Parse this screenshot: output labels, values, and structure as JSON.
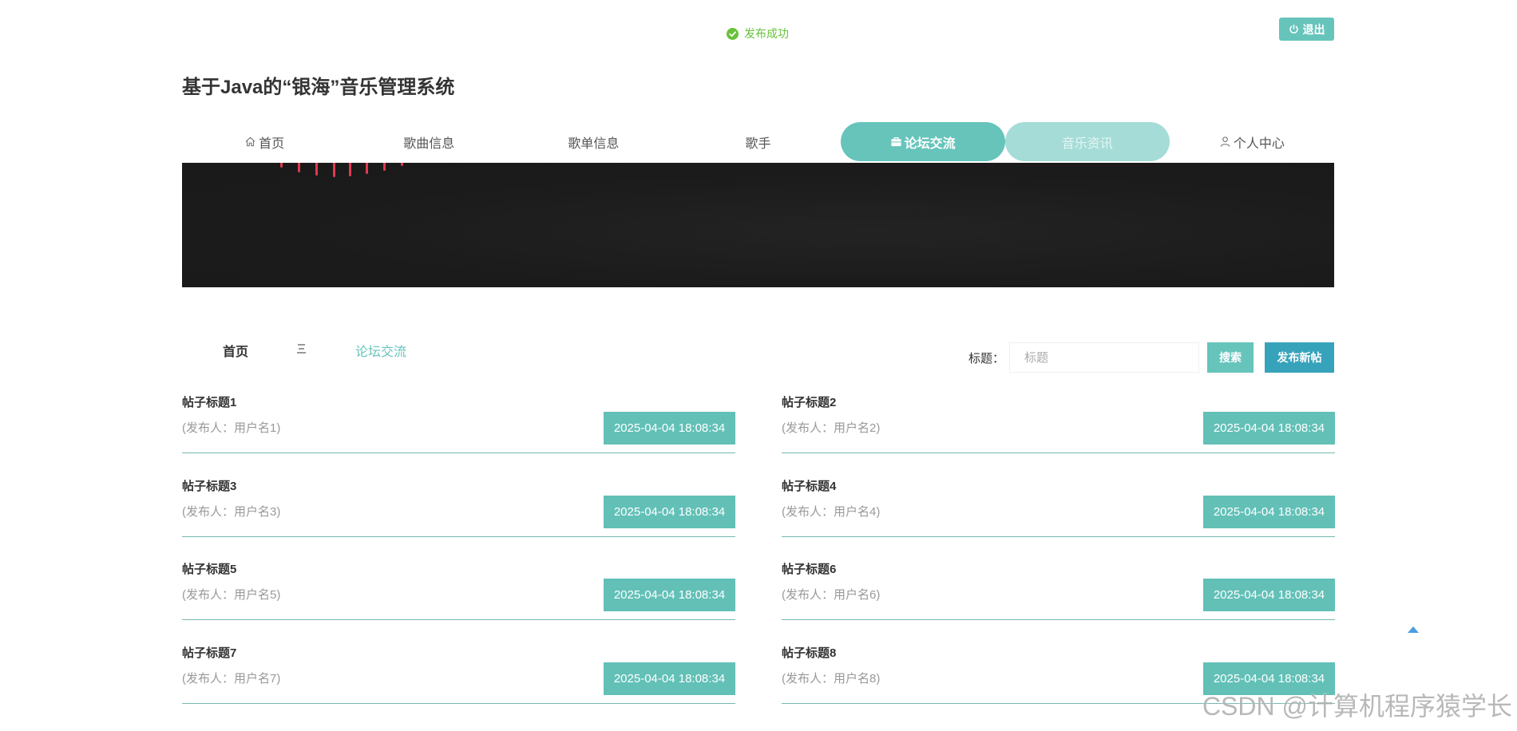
{
  "toast": {
    "text": "发布成功"
  },
  "header": {
    "logout_label": "退出",
    "title": "基于Java的“银海”音乐管理系统"
  },
  "nav": {
    "items": [
      {
        "label": "首页",
        "icon": "home-icon",
        "active": false,
        "hovered": false
      },
      {
        "label": "歌曲信息",
        "active": false,
        "hovered": false
      },
      {
        "label": "歌单信息",
        "active": false,
        "hovered": false
      },
      {
        "label": "歌手",
        "active": false,
        "hovered": false
      },
      {
        "label": "论坛交流",
        "icon": "briefcase-icon",
        "active": true,
        "hovered": false
      },
      {
        "label": "音乐资讯",
        "active": false,
        "hovered": true
      },
      {
        "label": "个人中心",
        "icon": "user-icon",
        "active": false,
        "hovered": false
      }
    ]
  },
  "breadcrumb": {
    "home": "首页",
    "current": "论坛交流"
  },
  "search": {
    "label": "标题：",
    "placeholder": "标题",
    "value": "",
    "search_button": "搜索",
    "publish_button": "发布新帖"
  },
  "posts": [
    {
      "title": "帖子标题1",
      "publisher": "(发布人：用户名1)",
      "time": "2025-04-04 18:08:34"
    },
    {
      "title": "帖子标题2",
      "publisher": "(发布人：用户名2)",
      "time": "2025-04-04 18:08:34"
    },
    {
      "title": "帖子标题3",
      "publisher": "(发布人：用户名3)",
      "time": "2025-04-04 18:08:34"
    },
    {
      "title": "帖子标题4",
      "publisher": "(发布人：用户名4)",
      "time": "2025-04-04 18:08:34"
    },
    {
      "title": "帖子标题5",
      "publisher": "(发布人：用户名5)",
      "time": "2025-04-04 18:08:34"
    },
    {
      "title": "帖子标题6",
      "publisher": "(发布人：用户名6)",
      "time": "2025-04-04 18:08:34"
    },
    {
      "title": "帖子标题7",
      "publisher": "(发布人：用户名7)",
      "time": "2025-04-04 18:08:34"
    },
    {
      "title": "帖子标题8",
      "publisher": "(发布人：用户名8)",
      "time": "2025-04-04 18:08:34"
    }
  ],
  "watermark": "CSDN @计算机程序猿学长",
  "colors": {
    "accent": "#66c4bb",
    "accent_hover": "#a5dcd7",
    "publish": "#37a3bb",
    "success": "#67c23a",
    "badge": "#62c0b7",
    "line": "#76b9b2"
  }
}
